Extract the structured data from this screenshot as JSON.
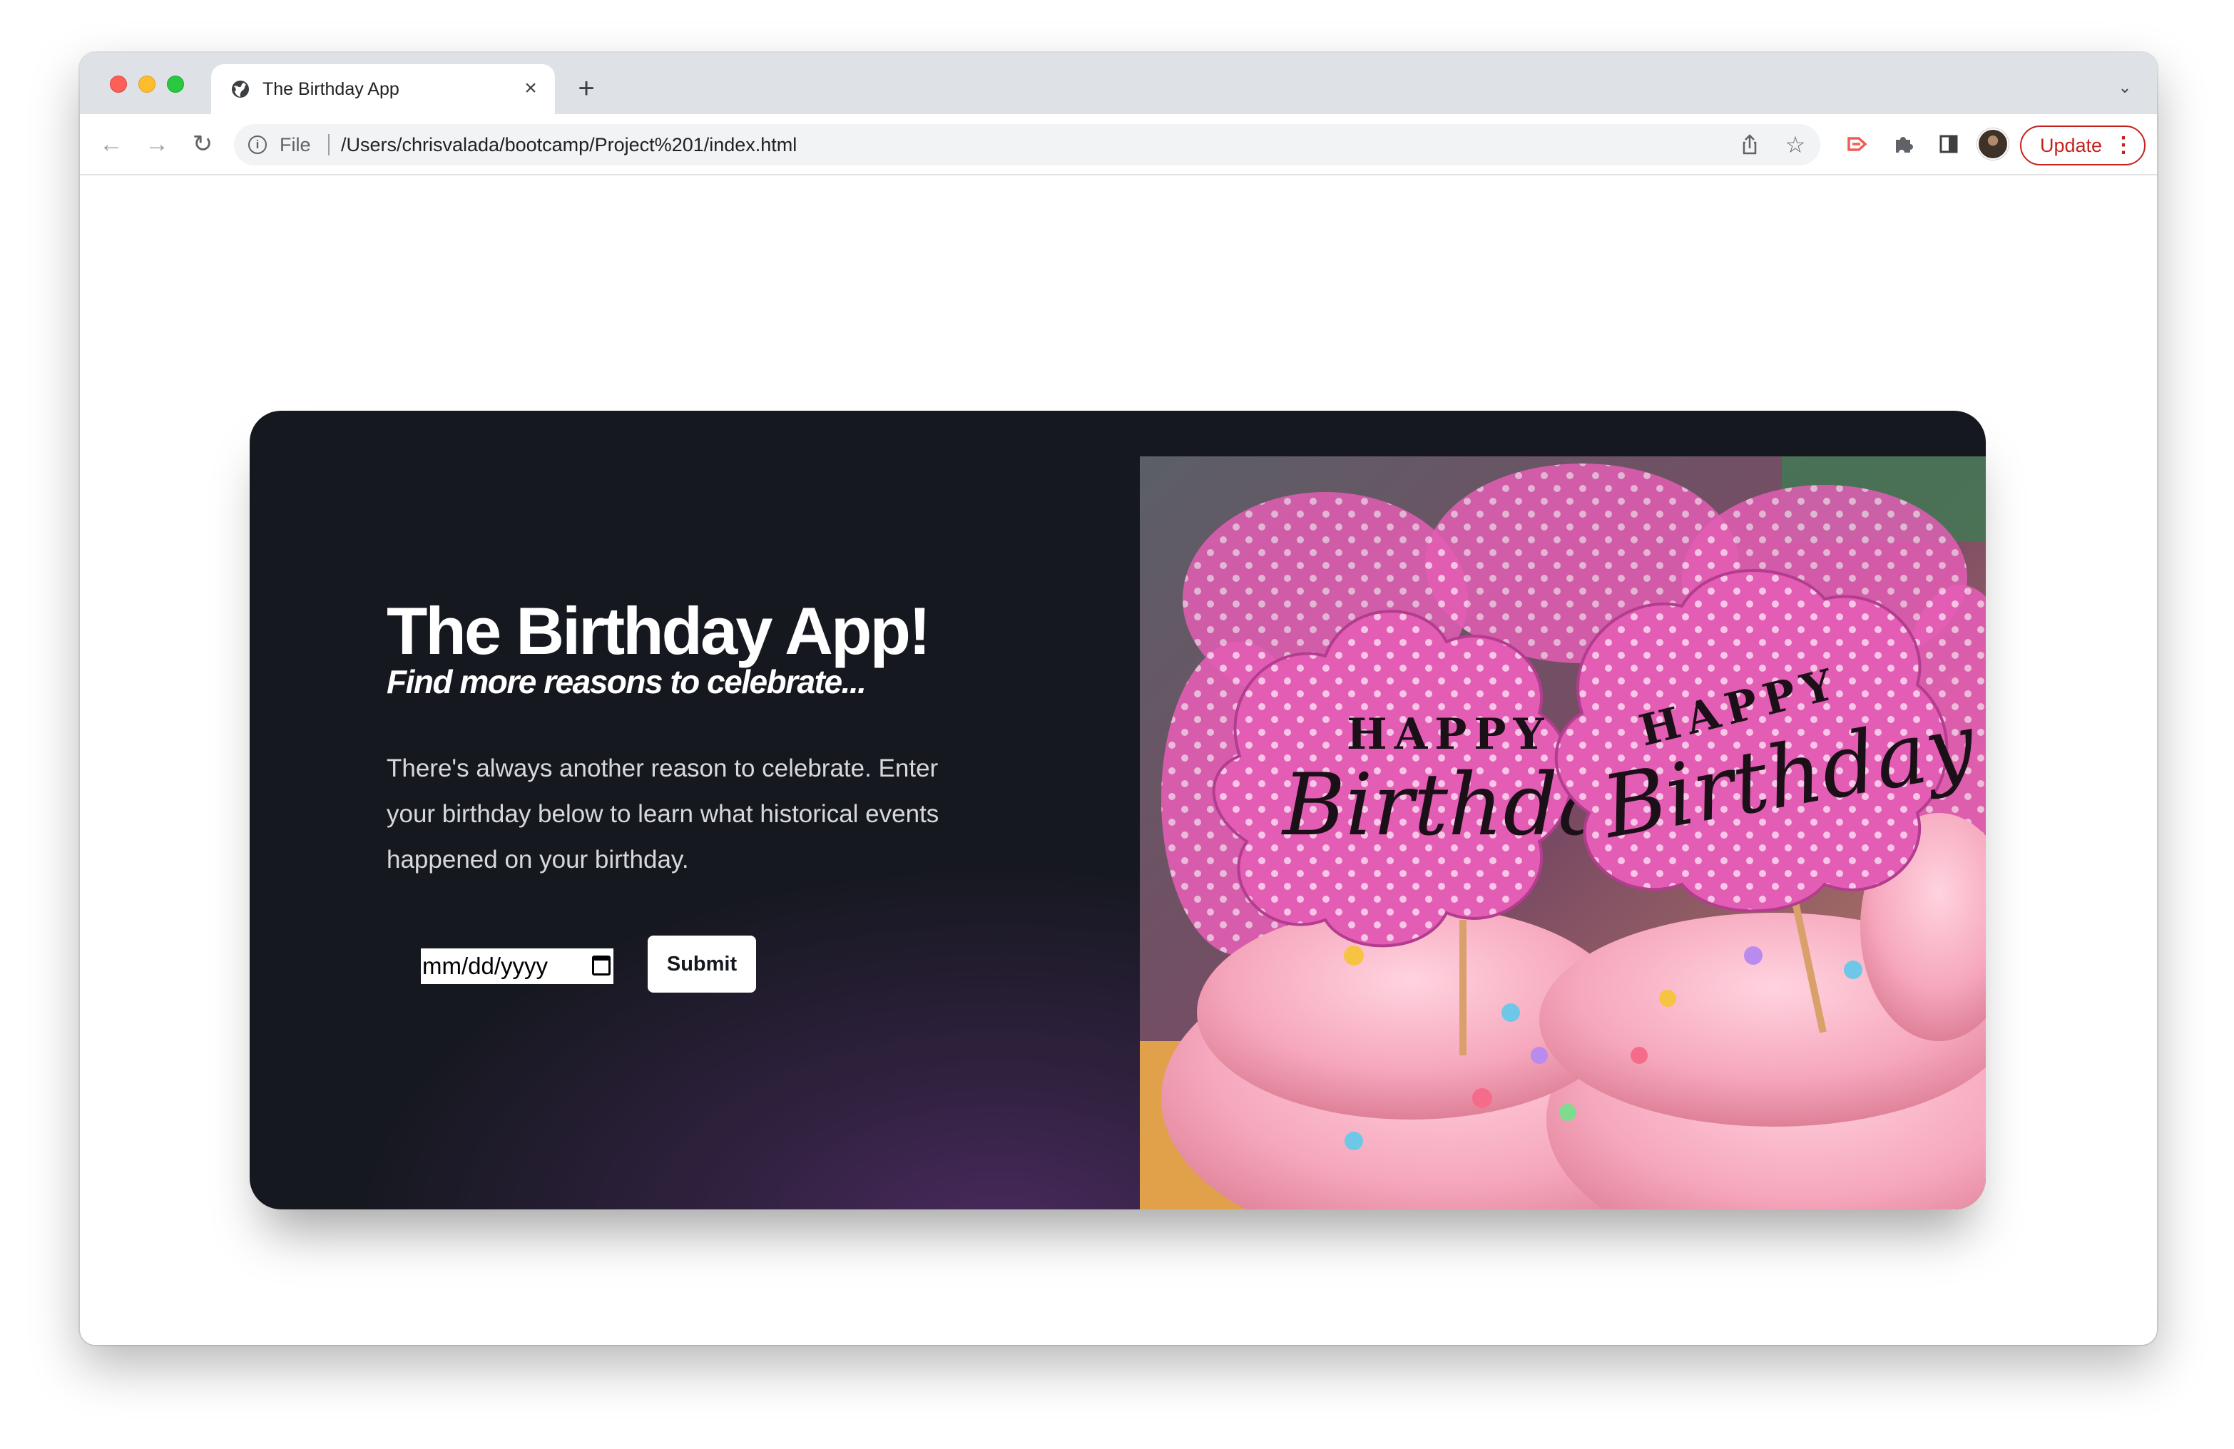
{
  "browser": {
    "tab_title": "The Birthday App",
    "tab_close_glyph": "×",
    "new_tab_glyph": "+",
    "scheme_label": "File",
    "url": "/Users/chrisvalada/bootcamp/Project%201/index.html",
    "update_label": "Update"
  },
  "page": {
    "title": "The Birthday App!",
    "subtitle": "Find more reasons to celebrate...",
    "description": "There's always another reason to celebrate. Enter your birthday below to learn what historical events happened on your birthday.",
    "date_placeholder": "mm/dd/yyyy",
    "submit_label": "Submit"
  },
  "photo": {
    "topper_small_line": "HAPPY",
    "topper_script_line": "Birthday"
  },
  "colors": {
    "hero_background": "#161820",
    "hero_glow": "#4a2a5e",
    "topper_pink": "#e65fb8",
    "frosting_pink": "#f6a7bd",
    "update_red": "#c5221f"
  }
}
